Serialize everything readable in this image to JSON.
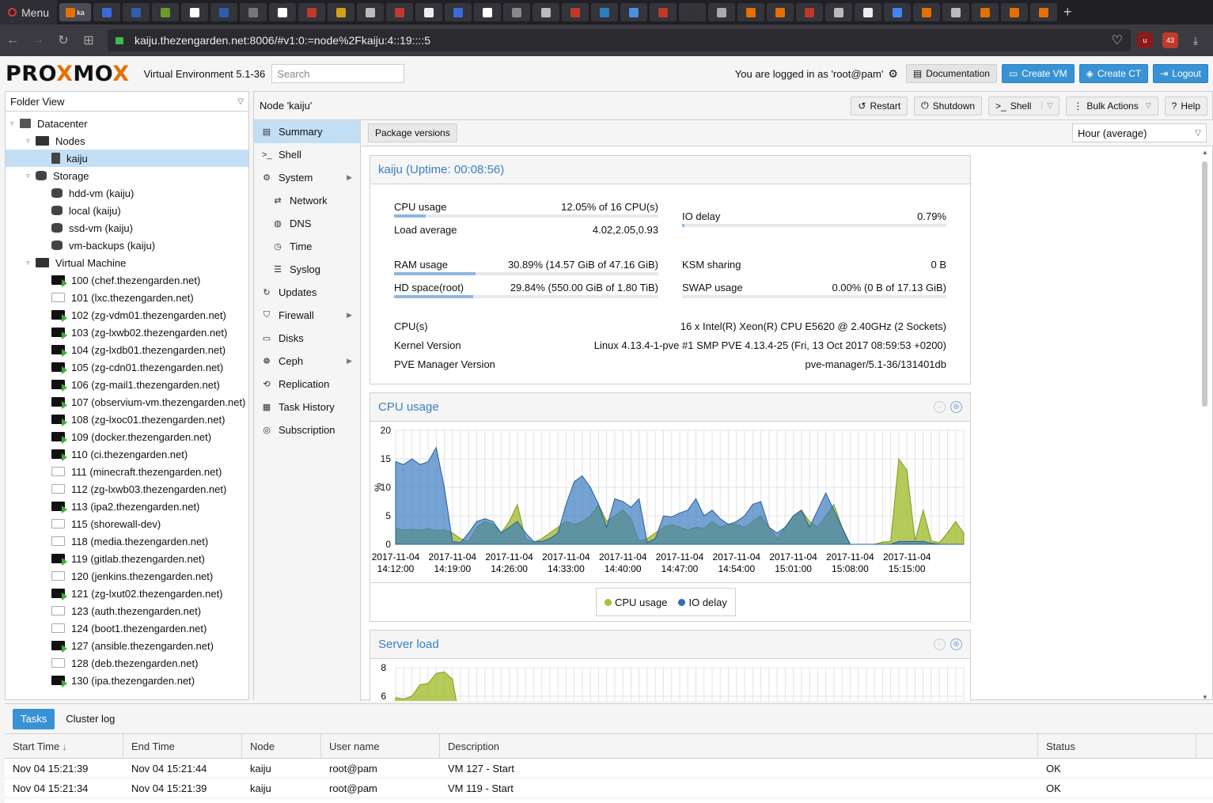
{
  "browser": {
    "menu_label": "Menu",
    "active_tab_label": "ka",
    "url": "kaiju.thezengarden.net:8006/#v1:0:=node%2Fkaiju:4::19::::5",
    "extension_badge": "43"
  },
  "header": {
    "logo_pre": "PRO",
    "logo_x": "X",
    "logo_mid": "MO",
    "logo_x2": "X",
    "version": "Virtual Environment 5.1-36",
    "search_placeholder": "Search",
    "logged_in": "You are logged in as 'root@pam'",
    "documentation": "Documentation",
    "create_vm": "Create VM",
    "create_ct": "Create CT",
    "logout": "Logout"
  },
  "tree": {
    "view": "Folder View",
    "datacenter": "Datacenter",
    "nodes": "Nodes",
    "node": "kaiju",
    "storage": "Storage",
    "storages": [
      "hdd-vm (kaiju)",
      "local (kaiju)",
      "ssd-vm (kaiju)",
      "vm-backups (kaiju)"
    ],
    "vm_group": "Virtual Machine",
    "vms": [
      {
        "label": "100 (chef.thezengarden.net)",
        "running": true
      },
      {
        "label": "101 (lxc.thezengarden.net)",
        "running": false
      },
      {
        "label": "102 (zg-vdm01.thezengarden.net)",
        "running": true
      },
      {
        "label": "103 (zg-lxwb02.thezengarden.net)",
        "running": true
      },
      {
        "label": "104 (zg-lxdb01.thezengarden.net)",
        "running": true
      },
      {
        "label": "105 (zg-cdn01.thezengarden.net)",
        "running": true
      },
      {
        "label": "106 (zg-mail1.thezengarden.net)",
        "running": true
      },
      {
        "label": "107 (observium-vm.thezengarden.net)",
        "running": true
      },
      {
        "label": "108 (zg-lxoc01.thezengarden.net)",
        "running": true
      },
      {
        "label": "109 (docker.thezengarden.net)",
        "running": true
      },
      {
        "label": "110 (ci.thezengarden.net)",
        "running": true
      },
      {
        "label": "111 (minecraft.thezengarden.net)",
        "running": false
      },
      {
        "label": "112 (zg-lxwb03.thezengarden.net)",
        "running": false
      },
      {
        "label": "113 (ipa2.thezengarden.net)",
        "running": true
      },
      {
        "label": "115 (shorewall-dev)",
        "running": false
      },
      {
        "label": "118 (media.thezengarden.net)",
        "running": false
      },
      {
        "label": "119 (gitlab.thezengarden.net)",
        "running": true
      },
      {
        "label": "120 (jenkins.thezengarden.net)",
        "running": false
      },
      {
        "label": "121 (zg-lxut02.thezengarden.net)",
        "running": true
      },
      {
        "label": "123 (auth.thezengarden.net)",
        "running": false
      },
      {
        "label": "124 (boot1.thezengarden.net)",
        "running": false
      },
      {
        "label": "127 (ansible.thezengarden.net)",
        "running": true
      },
      {
        "label": "128 (deb.thezengarden.net)",
        "running": false
      },
      {
        "label": "130 (ipa.thezengarden.net)",
        "running": true
      }
    ]
  },
  "node_toolbar": {
    "title": "Node 'kaiju'",
    "restart": "Restart",
    "shutdown": "Shutdown",
    "shell": "Shell",
    "bulk": "Bulk Actions",
    "help": "Help"
  },
  "nav": [
    {
      "label": "Summary",
      "icon": "book-icon",
      "glyph": "▤",
      "sub": false,
      "sel": true,
      "arrow": false
    },
    {
      "label": "Shell",
      "icon": "terminal-icon",
      "glyph": ">_",
      "sub": false,
      "sel": false,
      "arrow": false
    },
    {
      "label": "System",
      "icon": "cogs-icon",
      "glyph": "⚙",
      "sub": false,
      "sel": false,
      "arrow": true
    },
    {
      "label": "Network",
      "icon": "exchange-icon",
      "glyph": "⇄",
      "sub": true,
      "sel": false,
      "arrow": false
    },
    {
      "label": "DNS",
      "icon": "globe-icon",
      "glyph": "◍",
      "sub": true,
      "sel": false,
      "arrow": false
    },
    {
      "label": "Time",
      "icon": "clock-icon",
      "glyph": "◷",
      "sub": true,
      "sel": false,
      "arrow": false
    },
    {
      "label": "Syslog",
      "icon": "list-icon",
      "glyph": "☰",
      "sub": true,
      "sel": false,
      "arrow": false
    },
    {
      "label": "Updates",
      "icon": "refresh-icon",
      "glyph": "↻",
      "sub": false,
      "sel": false,
      "arrow": false
    },
    {
      "label": "Firewall",
      "icon": "shield-icon",
      "glyph": "⛉",
      "sub": false,
      "sel": false,
      "arrow": true
    },
    {
      "label": "Disks",
      "icon": "hdd-icon",
      "glyph": "▭",
      "sub": false,
      "sel": false,
      "arrow": false
    },
    {
      "label": "Ceph",
      "icon": "ceph-icon",
      "glyph": "☸",
      "sub": false,
      "sel": false,
      "arrow": true
    },
    {
      "label": "Replication",
      "icon": "retweet-icon",
      "glyph": "⟲",
      "sub": false,
      "sel": false,
      "arrow": false
    },
    {
      "label": "Task History",
      "icon": "list-alt-icon",
      "glyph": "▦",
      "sub": false,
      "sel": false,
      "arrow": false
    },
    {
      "label": "Subscription",
      "icon": "support-icon",
      "glyph": "◎",
      "sub": false,
      "sel": false,
      "arrow": false
    }
  ],
  "summary": {
    "package_versions": "Package versions",
    "timeframe": "Hour (average)",
    "status_title": "kaiju (Uptime: 00:08:56)",
    "stats": {
      "cpu_label": "CPU usage",
      "cpu_value": "12.05% of 16 CPU(s)",
      "cpu_fraction": 0.12,
      "load_label": "Load average",
      "load_value": "4.02,2.05,0.93",
      "io_label": "IO delay",
      "io_value": "0.79%",
      "io_fraction": 0.008,
      "ram_label": "RAM usage",
      "ram_value": "30.89% (14.57 GiB of 47.16 GiB)",
      "ram_fraction": 0.3089,
      "ksm_label": "KSM sharing",
      "ksm_value": "0 B",
      "hd_label": "HD space(root)",
      "hd_value": "29.84% (550.00 GiB of 1.80 TiB)",
      "hd_fraction": 0.2984,
      "swap_label": "SWAP usage",
      "swap_value": "0.00% (0 B of 17.13 GiB)",
      "swap_fraction": 0.0,
      "cpus_label": "CPU(s)",
      "cpus_value": "16 x Intel(R) Xeon(R) CPU E5620 @ 2.40GHz (2 Sockets)",
      "kernel_label": "Kernel Version",
      "kernel_value": "Linux 4.13.4-1-pve #1 SMP PVE 4.13.4-25 (Fri, 13 Oct 2017 08:59:53 +0200)",
      "pve_label": "PVE Manager Version",
      "pve_value": "pve-manager/5.1-36/131401db"
    },
    "cpu_panel_title": "CPU usage",
    "load_panel_title": "Server load"
  },
  "colors": {
    "cpu": "#a7c13c",
    "io": "#3b7cc0",
    "accent": "#3892d4"
  },
  "chart_data": [
    {
      "type": "area",
      "title": "CPU usage",
      "ylabel": "%",
      "ylim": [
        0,
        20
      ],
      "yticks": [
        "0",
        "5",
        "10",
        "15",
        "20"
      ],
      "xtick_dates": [
        "2017-11-04",
        "2017-11-04",
        "2017-11-04",
        "2017-11-04",
        "2017-11-04",
        "2017-11-04",
        "2017-11-04",
        "2017-11-04",
        "2017-11-04",
        "2017-11-04"
      ],
      "xtick_times": [
        "14:12:00",
        "14:19:00",
        "14:26:00",
        "14:33:00",
        "14:40:00",
        "14:47:00",
        "14:54:00",
        "15:01:00",
        "15:08:00",
        "15:15:00"
      ],
      "x_minutes": [
        0,
        1,
        2,
        3,
        4,
        5,
        6,
        7,
        8,
        9,
        10,
        11,
        12,
        13,
        14,
        15,
        16,
        17,
        18,
        19,
        20,
        21,
        22,
        23,
        24,
        25,
        26,
        27,
        28,
        29,
        30,
        31,
        32,
        33,
        34,
        35,
        36,
        37,
        38,
        39,
        40,
        41,
        42,
        43,
        44,
        45,
        46,
        47,
        48,
        49,
        50,
        51,
        52,
        53,
        54,
        55,
        56,
        57,
        58,
        59,
        60,
        61,
        62,
        63,
        64,
        65,
        66,
        67,
        68,
        69,
        70
      ],
      "series": [
        {
          "name": "CPU usage",
          "values": [
            2.8,
            2.5,
            2.6,
            2.5,
            2.7,
            2.4,
            2.5,
            2,
            1,
            0.5,
            3,
            4,
            3.5,
            2,
            4,
            7,
            1,
            0.3,
            1,
            2,
            3,
            4,
            3.5,
            4,
            5,
            7,
            4,
            5,
            6,
            4.5,
            0.5,
            1,
            2,
            3,
            3.5,
            3,
            2.5,
            3,
            2.8,
            4,
            3,
            3.5,
            3.5,
            3,
            4,
            5,
            3,
            1,
            3,
            5,
            6,
            4,
            3,
            5,
            7,
            3,
            0,
            0,
            0,
            0,
            0.4,
            0.5,
            15,
            13,
            0.6,
            6,
            0.6,
            0.3,
            2,
            4,
            2
          ]
        },
        {
          "name": "IO delay",
          "values": [
            14.5,
            14,
            15,
            14,
            14.5,
            17,
            10,
            0.5,
            0.3,
            2,
            4,
            4.5,
            4,
            2,
            3,
            4,
            2,
            0.5,
            0.5,
            1,
            2,
            7,
            11,
            12,
            10,
            7,
            3,
            8,
            7.5,
            6.5,
            8,
            0.3,
            1,
            5,
            4.8,
            5.5,
            6,
            8,
            5,
            6,
            4.5,
            3.5,
            4,
            5,
            7,
            7.5,
            3,
            2,
            3,
            5,
            6,
            3,
            6,
            9,
            6,
            3,
            0,
            0,
            0,
            0,
            0,
            0,
            0.5,
            0.5,
            0.5,
            0.5,
            0.2,
            0,
            0,
            0,
            0
          ]
        }
      ]
    },
    {
      "type": "area",
      "title": "Server load",
      "ylim": [
        0,
        8
      ],
      "yticks": [
        "6",
        "8"
      ],
      "x_minutes": [
        0,
        1,
        2,
        3,
        4,
        5,
        6,
        7,
        8,
        9,
        10
      ],
      "series": [
        {
          "name": "Load average",
          "values": [
            5.9,
            5.8,
            6,
            6.8,
            6.9,
            7.6,
            7.7,
            7.2,
            4,
            2,
            1
          ]
        }
      ]
    }
  ],
  "bottom": {
    "tab_tasks": "Tasks",
    "tab_cluster_log": "Cluster log",
    "columns": [
      "Start Time",
      "End Time",
      "Node",
      "User name",
      "Description",
      "Status"
    ],
    "sort_indicator": "↓",
    "rows": [
      [
        "Nov 04 15:21:39",
        "Nov 04 15:21:44",
        "kaiju",
        "root@pam",
        "VM 127 - Start",
        "OK"
      ],
      [
        "Nov 04 15:21:34",
        "Nov 04 15:21:39",
        "kaiju",
        "root@pam",
        "VM 119 - Start",
        "OK"
      ]
    ]
  }
}
